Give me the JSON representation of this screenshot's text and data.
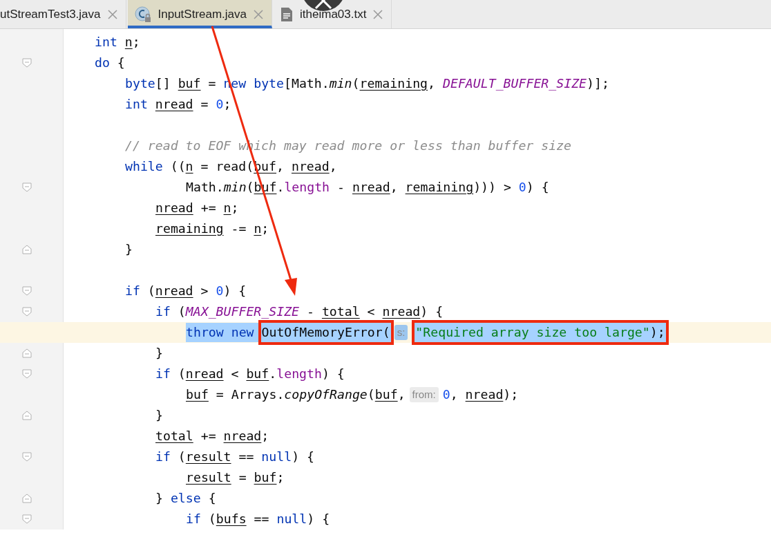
{
  "tabs": [
    {
      "label": "utStreamTest3.java",
      "kind": "java",
      "selected": false
    },
    {
      "label": "InputStream.java",
      "kind": "class",
      "selected": true
    },
    {
      "label": "itheima03.txt",
      "kind": "text",
      "selected": false
    }
  ],
  "lines": [
    {
      "current": false,
      "segments": [
        {
          "kind": "code",
          "selected": false,
          "tokens": [
            {
              "kind": "keyword",
              "text": "        int "
            },
            {
              "kind": "var",
              "text": "n"
            },
            {
              "kind": "plain",
              "text": ";"
            }
          ]
        }
      ]
    },
    {
      "current": false,
      "fold_marker": {
        "kind": "open"
      },
      "segments": [
        {
          "kind": "code",
          "selected": false,
          "tokens": [
            {
              "kind": "keyword",
              "text": "        do"
            },
            {
              "kind": "plain",
              "text": " {"
            }
          ]
        }
      ]
    },
    {
      "current": false,
      "segments": [
        {
          "kind": "code",
          "selected": false,
          "tokens": [
            {
              "kind": "keyword",
              "text": "            byte"
            },
            {
              "kind": "plain",
              "text": "[] "
            },
            {
              "kind": "var",
              "text": "buf"
            },
            {
              "kind": "plain",
              "text": " = "
            },
            {
              "kind": "keyword",
              "text": "new byte"
            },
            {
              "kind": "plain",
              "text": "[Math."
            },
            {
              "kind": "static",
              "text": "min"
            },
            {
              "kind": "plain",
              "text": "("
            },
            {
              "kind": "var",
              "text": "remaining"
            },
            {
              "kind": "plain",
              "text": ", "
            },
            {
              "kind": "const",
              "text": "DEFAULT_BUFFER_SIZE"
            },
            {
              "kind": "plain",
              "text": ")];"
            }
          ]
        }
      ]
    },
    {
      "current": false,
      "segments": [
        {
          "kind": "code",
          "selected": false,
          "tokens": [
            {
              "kind": "keyword",
              "text": "            int "
            },
            {
              "kind": "var",
              "text": "nread"
            },
            {
              "kind": "plain",
              "text": " = "
            },
            {
              "kind": "number",
              "text": "0"
            },
            {
              "kind": "plain",
              "text": ";"
            }
          ]
        }
      ]
    },
    {
      "current": false
    },
    {
      "current": false,
      "segments": [
        {
          "kind": "code",
          "selected": false,
          "tokens": [
            {
              "kind": "comment",
              "text": "            // read to EOF which may read more or less than buffer size"
            }
          ]
        }
      ]
    },
    {
      "current": false,
      "segments": [
        {
          "kind": "code",
          "selected": false,
          "tokens": [
            {
              "kind": "keyword",
              "text": "            while"
            },
            {
              "kind": "plain",
              "text": " (("
            },
            {
              "kind": "var",
              "text": "n"
            },
            {
              "kind": "plain",
              "text": " = read("
            },
            {
              "kind": "var",
              "text": "buf"
            },
            {
              "kind": "plain",
              "text": ", "
            },
            {
              "kind": "var",
              "text": "nread"
            },
            {
              "kind": "plain",
              "text": ","
            }
          ]
        }
      ]
    },
    {
      "current": false,
      "fold_marker": {
        "kind": "open"
      },
      "segments": [
        {
          "kind": "code",
          "selected": false,
          "tokens": [
            {
              "kind": "plain",
              "text": "                    Math."
            },
            {
              "kind": "static",
              "text": "min"
            },
            {
              "kind": "plain",
              "text": "("
            },
            {
              "kind": "var",
              "text": "buf"
            },
            {
              "kind": "plain",
              "text": "."
            },
            {
              "kind": "field",
              "text": "length"
            },
            {
              "kind": "plain",
              "text": " - "
            },
            {
              "kind": "var",
              "text": "nread"
            },
            {
              "kind": "plain",
              "text": ", "
            },
            {
              "kind": "var",
              "text": "remaining"
            },
            {
              "kind": "plain",
              "text": "))) > "
            },
            {
              "kind": "number",
              "text": "0"
            },
            {
              "kind": "plain",
              "text": ") {"
            }
          ]
        }
      ]
    },
    {
      "current": false,
      "segments": [
        {
          "kind": "code",
          "selected": false,
          "tokens": [
            {
              "kind": "var",
              "text": "                nread"
            },
            {
              "kind": "plain",
              "text": " += "
            },
            {
              "kind": "var",
              "text": "n"
            },
            {
              "kind": "plain",
              "text": ";"
            }
          ]
        }
      ]
    },
    {
      "current": false,
      "segments": [
        {
          "kind": "code",
          "selected": false,
          "tokens": [
            {
              "kind": "var",
              "text": "                remaining"
            },
            {
              "kind": "plain",
              "text": " -= "
            },
            {
              "kind": "var",
              "text": "n"
            },
            {
              "kind": "plain",
              "text": ";"
            }
          ]
        }
      ]
    },
    {
      "current": false,
      "fold_marker": {
        "kind": "close"
      },
      "segments": [
        {
          "kind": "code",
          "selected": false,
          "tokens": [
            {
              "kind": "plain",
              "text": "            }"
            }
          ]
        }
      ]
    },
    {
      "current": false
    },
    {
      "current": false,
      "fold_marker": {
        "kind": "open"
      },
      "segments": [
        {
          "kind": "code",
          "selected": false,
          "tokens": [
            {
              "kind": "keyword",
              "text": "            if"
            },
            {
              "kind": "plain",
              "text": " ("
            },
            {
              "kind": "var",
              "text": "nread"
            },
            {
              "kind": "plain",
              "text": " > "
            },
            {
              "kind": "number",
              "text": "0"
            },
            {
              "kind": "plain",
              "text": ") {"
            }
          ]
        }
      ]
    },
    {
      "current": false,
      "fold_marker": {
        "kind": "open"
      },
      "segments": [
        {
          "kind": "code",
          "selected": false,
          "tokens": [
            {
              "kind": "keyword",
              "text": "                if"
            },
            {
              "kind": "plain",
              "text": " ("
            },
            {
              "kind": "const",
              "text": "MAX_BUFFER_SIZE"
            },
            {
              "kind": "plain",
              "text": " - "
            },
            {
              "kind": "var",
              "text": "total"
            },
            {
              "kind": "plain",
              "text": " < "
            },
            {
              "kind": "var",
              "text": "nread"
            },
            {
              "kind": "plain",
              "text": ") {"
            }
          ]
        }
      ]
    },
    {
      "current": true,
      "segments": [
        {
          "kind": "code",
          "selected": true,
          "tokens": [
            {
              "kind": "keyword",
              "text": "                    throw new "
            }
          ]
        },
        {
          "kind": "code",
          "selected": true,
          "boxed": true,
          "tokens": [
            {
              "kind": "plain",
              "text": "OutOfMemoryError("
            }
          ]
        },
        {
          "kind": "hint",
          "selected": true,
          "text": "s:"
        },
        {
          "kind": "code",
          "selected": true,
          "boxed": true,
          "tokens": [
            {
              "kind": "string",
              "text": "\"Required array size too large\""
            },
            {
              "kind": "plain",
              "text": ");"
            }
          ]
        }
      ]
    },
    {
      "current": false,
      "fold_marker": {
        "kind": "close"
      },
      "segments": [
        {
          "kind": "code",
          "selected": false,
          "tokens": [
            {
              "kind": "plain",
              "text": "                }"
            }
          ]
        }
      ]
    },
    {
      "current": false,
      "fold_marker": {
        "kind": "open"
      },
      "segments": [
        {
          "kind": "code",
          "selected": false,
          "tokens": [
            {
              "kind": "keyword",
              "text": "                if"
            },
            {
              "kind": "plain",
              "text": " ("
            },
            {
              "kind": "var",
              "text": "nread"
            },
            {
              "kind": "plain",
              "text": " < "
            },
            {
              "kind": "var",
              "text": "buf"
            },
            {
              "kind": "plain",
              "text": "."
            },
            {
              "kind": "field",
              "text": "length"
            },
            {
              "kind": "plain",
              "text": ") {"
            }
          ]
        }
      ]
    },
    {
      "current": false,
      "segments": [
        {
          "kind": "code",
          "selected": false,
          "tokens": [
            {
              "kind": "var",
              "text": "                    buf"
            },
            {
              "kind": "plain",
              "text": " = Arrays."
            },
            {
              "kind": "static",
              "text": "copyOfRange"
            },
            {
              "kind": "plain",
              "text": "("
            },
            {
              "kind": "var",
              "text": "buf"
            },
            {
              "kind": "plain",
              "text": ","
            }
          ]
        },
        {
          "kind": "hint",
          "selected": false,
          "text": "from:"
        },
        {
          "kind": "code",
          "selected": false,
          "tokens": [
            {
              "kind": "number",
              "text": "0"
            },
            {
              "kind": "plain",
              "text": ", "
            },
            {
              "kind": "var",
              "text": "nread"
            },
            {
              "kind": "plain",
              "text": ");"
            }
          ]
        }
      ]
    },
    {
      "current": false,
      "fold_marker": {
        "kind": "close"
      },
      "segments": [
        {
          "kind": "code",
          "selected": false,
          "tokens": [
            {
              "kind": "plain",
              "text": "                }"
            }
          ]
        }
      ]
    },
    {
      "current": false,
      "segments": [
        {
          "kind": "code",
          "selected": false,
          "tokens": [
            {
              "kind": "var",
              "text": "                total"
            },
            {
              "kind": "plain",
              "text": " += "
            },
            {
              "kind": "var",
              "text": "nread"
            },
            {
              "kind": "plain",
              "text": ";"
            }
          ]
        }
      ]
    },
    {
      "current": false,
      "fold_marker": {
        "kind": "open"
      },
      "segments": [
        {
          "kind": "code",
          "selected": false,
          "tokens": [
            {
              "kind": "keyword",
              "text": "                if"
            },
            {
              "kind": "plain",
              "text": " ("
            },
            {
              "kind": "var",
              "text": "result"
            },
            {
              "kind": "plain",
              "text": " == "
            },
            {
              "kind": "keyword",
              "text": "null"
            },
            {
              "kind": "plain",
              "text": ") {"
            }
          ]
        }
      ]
    },
    {
      "current": false,
      "segments": [
        {
          "kind": "code",
          "selected": false,
          "tokens": [
            {
              "kind": "var",
              "text": "                    result"
            },
            {
              "kind": "plain",
              "text": " = "
            },
            {
              "kind": "var",
              "text": "buf"
            },
            {
              "kind": "plain",
              "text": ";"
            }
          ]
        }
      ]
    },
    {
      "current": false,
      "fold_marker": {
        "kind": "close"
      },
      "segments": [
        {
          "kind": "code",
          "selected": false,
          "tokens": [
            {
              "kind": "plain",
              "text": "                } "
            },
            {
              "kind": "keyword",
              "text": "else"
            },
            {
              "kind": "plain",
              "text": " {"
            }
          ]
        }
      ]
    },
    {
      "current": false,
      "fold_marker": {
        "kind": "open"
      },
      "segments": [
        {
          "kind": "code",
          "selected": false,
          "tokens": [
            {
              "kind": "keyword",
              "text": "                    if"
            },
            {
              "kind": "plain",
              "text": " ("
            },
            {
              "kind": "var",
              "text": "bufs"
            },
            {
              "kind": "plain",
              "text": " == "
            },
            {
              "kind": "keyword",
              "text": "null"
            },
            {
              "kind": "plain",
              "text": ") {"
            }
          ]
        }
      ]
    }
  ],
  "annotations": [
    {
      "kind": "arrow"
    }
  ]
}
